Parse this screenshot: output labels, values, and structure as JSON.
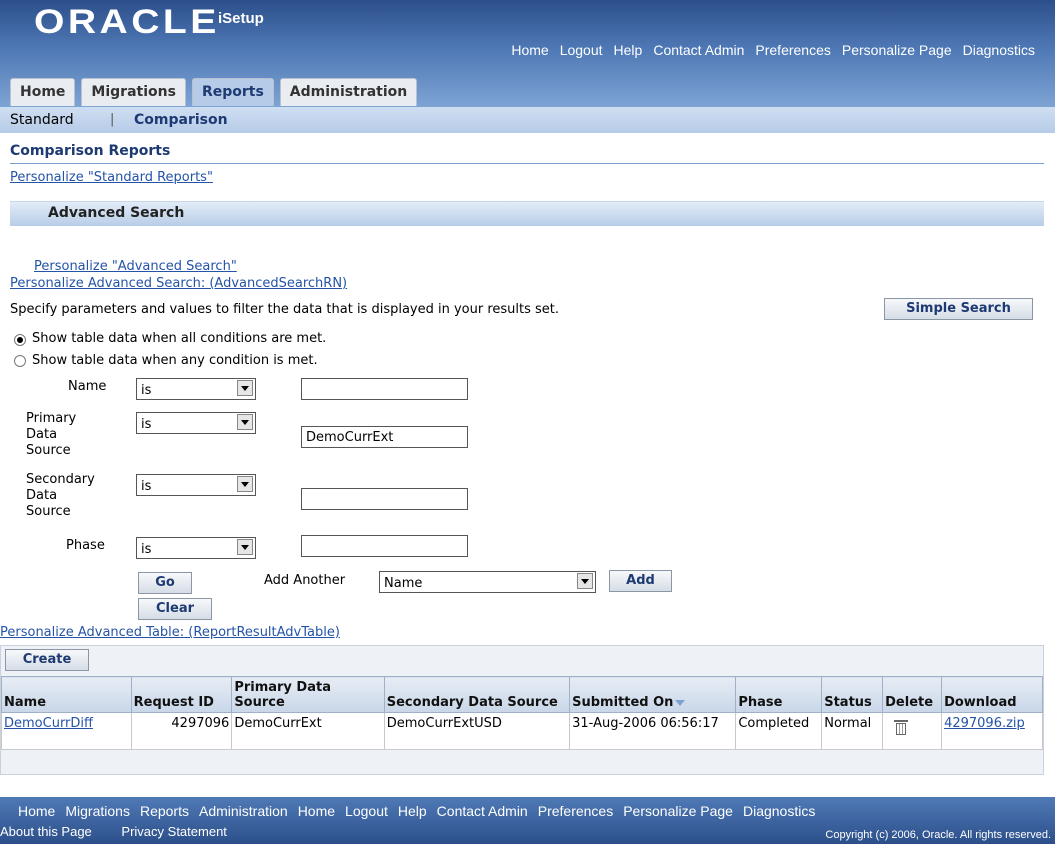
{
  "brand": {
    "logo": "ORACLE",
    "product": "iSetup"
  },
  "global_links": [
    "Home",
    "Logout",
    "Help",
    "Contact Admin",
    "Preferences",
    "Personalize Page",
    "Diagnostics"
  ],
  "tabs": [
    {
      "label": "Home"
    },
    {
      "label": "Migrations"
    },
    {
      "label": "Reports",
      "active": true
    },
    {
      "label": "Administration"
    }
  ],
  "subtabs": {
    "standard": "Standard",
    "separator": "|",
    "comparison": "Comparison"
  },
  "page": {
    "title": "Comparison Reports",
    "personalize_standard": "Personalize \"Standard Reports\"",
    "section_title": "Advanced Search",
    "personalize_adv": "Personalize \"Advanced Search\"",
    "personalize_adv_rn": "Personalize Advanced Search: (AdvancedSearchRN)",
    "instructions": "Specify parameters and values to filter the data that is displayed in your results set.",
    "simple_search": "Simple Search",
    "radio_all": "Show table data when all conditions are met.",
    "radio_any": "Show table data when any condition is met.",
    "radio_selected": "all"
  },
  "criteria": [
    {
      "label": "Name",
      "operator": "is",
      "value": ""
    },
    {
      "label": "Primary Data Source",
      "operator": "is",
      "value": "DemoCurrExt"
    },
    {
      "label": "Secondary Data Source",
      "operator": "is",
      "value": ""
    },
    {
      "label": "Phase",
      "operator": "is",
      "value": ""
    }
  ],
  "buttons": {
    "go": "Go",
    "clear": "Clear",
    "add_another": "Add Another",
    "add_another_value": "Name",
    "add": "Add",
    "create": "Create"
  },
  "personalize_table": "Personalize Advanced Table: (ReportResultAdvTable)",
  "table": {
    "columns": [
      "Name",
      "Request ID",
      "Primary Data Source",
      "Secondary Data Source",
      "Submitted On",
      "Phase",
      "Status",
      "Delete",
      "Download"
    ],
    "rows": [
      {
        "name": "DemoCurrDiff",
        "request_id": "4297096",
        "primary": "DemoCurrExt",
        "secondary": "DemoCurrExtUSD",
        "submitted": "31-Aug-2006 06:56:17",
        "phase": "Completed",
        "status": "Normal",
        "download": "4297096.zip"
      }
    ]
  },
  "footer": {
    "links": [
      "Home",
      "Migrations",
      "Reports",
      "Administration",
      "Home",
      "Logout",
      "Help",
      "Contact Admin",
      "Preferences",
      "Personalize Page",
      "Diagnostics"
    ],
    "about": "About this Page",
    "privacy": "Privacy Statement",
    "copyright": "Copyright (c) 2006, Oracle. All rights reserved."
  },
  "colors": {
    "brand_blue": "#2c4f8a",
    "link": "#2453a8",
    "tab_active": "#b6cbe8"
  }
}
